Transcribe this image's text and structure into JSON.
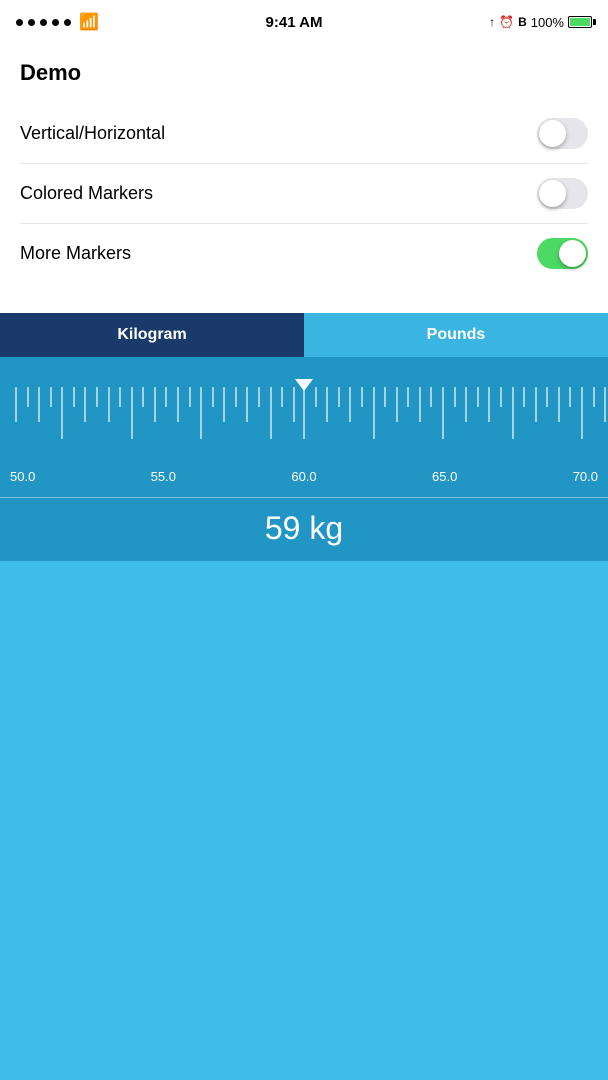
{
  "statusBar": {
    "time": "9:41 AM",
    "batteryPercent": "100%"
  },
  "settings": {
    "title": "Demo",
    "rows": [
      {
        "label": "Vertical/Horizontal",
        "state": "off"
      },
      {
        "label": "Colored Markers",
        "state": "off"
      },
      {
        "label": "More Markers",
        "state": "on"
      }
    ]
  },
  "ruler": {
    "tabs": [
      {
        "label": "Kilogram",
        "active": true
      },
      {
        "label": "Pounds",
        "active": false
      }
    ],
    "labels": [
      "50.0",
      "55.0",
      "60.0",
      "65.0",
      "70.0"
    ],
    "value": "59 kg"
  }
}
